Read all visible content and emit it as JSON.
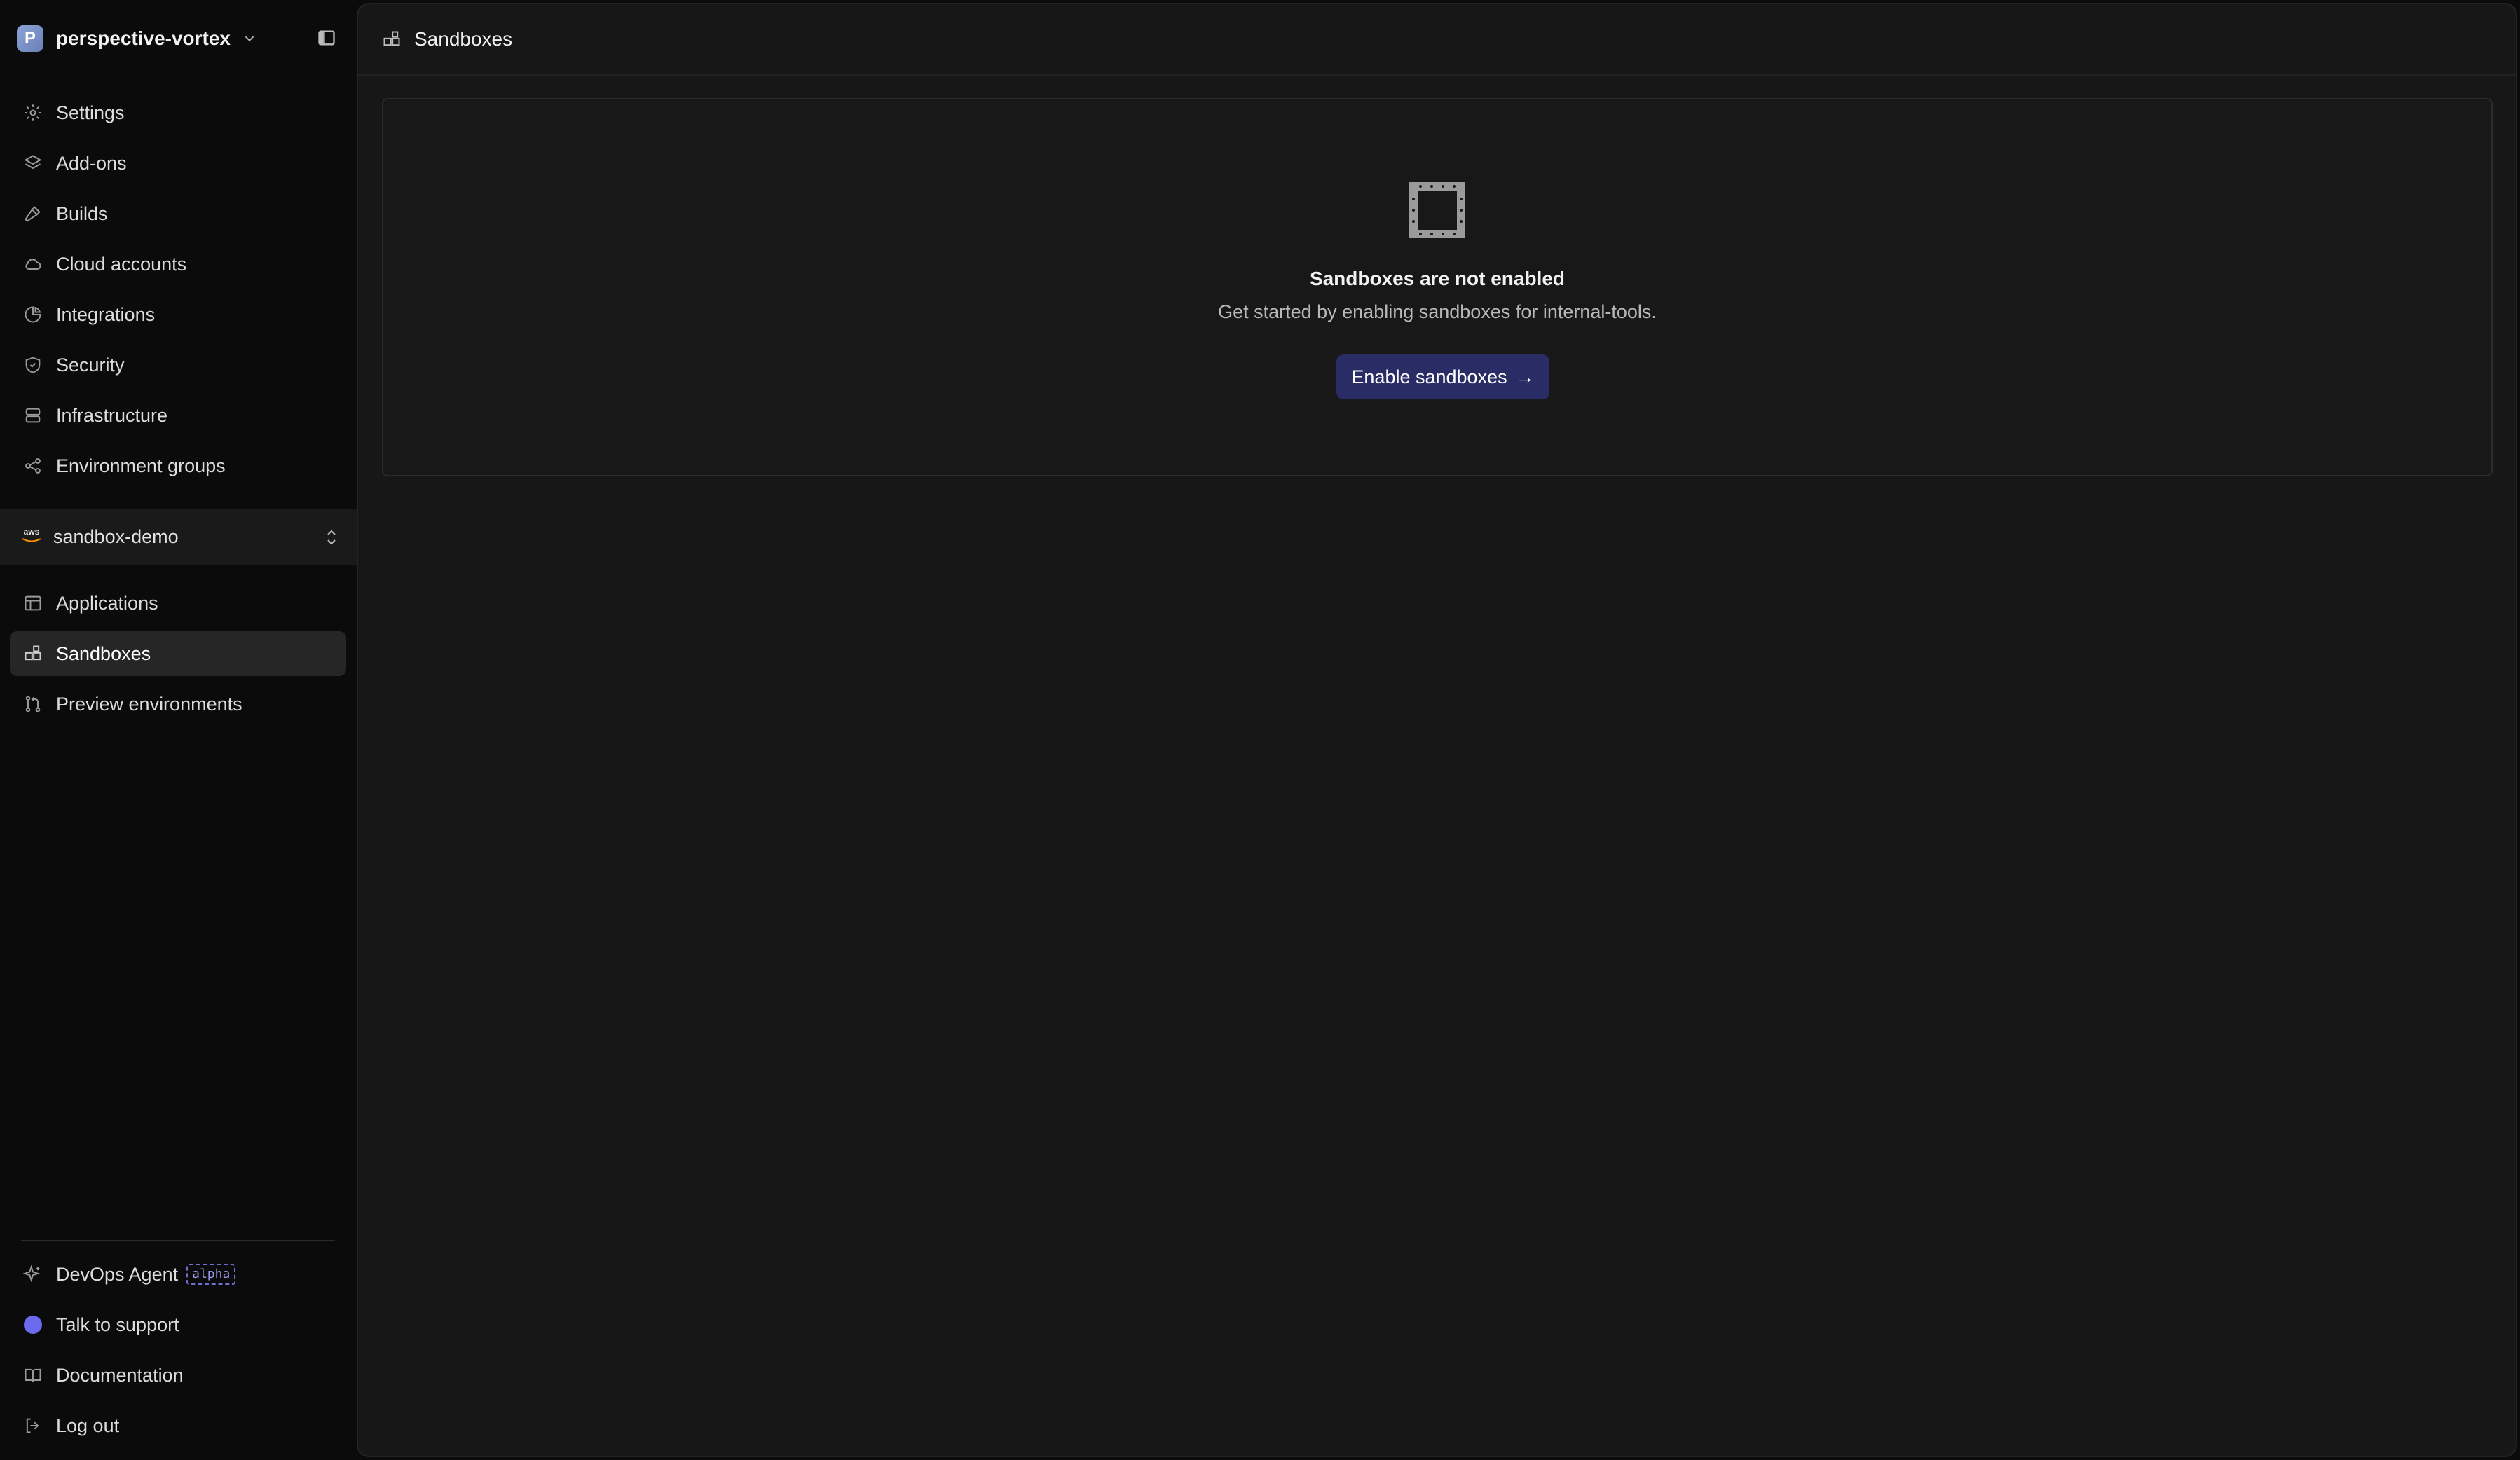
{
  "workspace": {
    "name": "perspective-vortex",
    "avatar_letter": "P"
  },
  "sidebar": {
    "top_items": [
      {
        "label": "Settings",
        "icon": "gear-icon"
      },
      {
        "label": "Add-ons",
        "icon": "layers-icon"
      },
      {
        "label": "Builds",
        "icon": "hammer-icon"
      },
      {
        "label": "Cloud accounts",
        "icon": "cloud-icon"
      },
      {
        "label": "Integrations",
        "icon": "pie-icon"
      },
      {
        "label": "Security",
        "icon": "shield-icon"
      },
      {
        "label": "Infrastructure",
        "icon": "server-icon"
      },
      {
        "label": "Environment groups",
        "icon": "share-icon"
      }
    ],
    "environment": {
      "name": "sandbox-demo",
      "provider_logo_text": "aws"
    },
    "env_items": [
      {
        "label": "Applications",
        "icon": "layout-icon"
      },
      {
        "label": "Sandboxes",
        "icon": "sandbox-icon",
        "active": true
      },
      {
        "label": "Preview environments",
        "icon": "git-pull-icon"
      }
    ],
    "bottom_items": [
      {
        "label": "DevOps Agent",
        "badge": "alpha",
        "icon": "sparkle-icon"
      },
      {
        "label": "Talk to support",
        "icon": "support-icon"
      },
      {
        "label": "Documentation",
        "icon": "book-icon"
      },
      {
        "label": "Log out",
        "icon": "logout-icon"
      }
    ]
  },
  "header": {
    "title": "Sandboxes"
  },
  "empty_state": {
    "title": "Sandboxes are not enabled",
    "description": "Get started by enabling sandboxes for internal-tools.",
    "button_label": "Enable sandboxes",
    "button_arrow": "→"
  },
  "colors": {
    "accent_button": "#2a2c66",
    "active_nav": "#262626",
    "support_dot": "#6b6bf0"
  }
}
